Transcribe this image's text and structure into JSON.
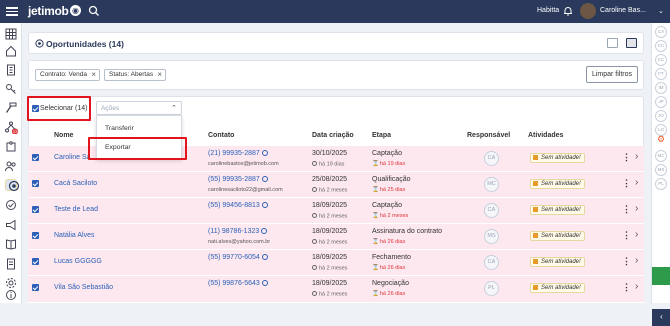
{
  "topbar": {
    "brand": "jetimob",
    "company": "Habitta",
    "user_name": "Caroline Bas...",
    "user_chevron": "⌄"
  },
  "page": {
    "title": "Oportunidades (14)"
  },
  "filters": {
    "chips": [
      {
        "label": "Contrato: Venda"
      },
      {
        "label": "Status: Abertas"
      }
    ],
    "clear_label": "Limpar filtros"
  },
  "bulk": {
    "select_label": "Selecionar (14)",
    "actions_placeholder": "Ações",
    "menu": [
      "Transferir",
      "Exportar"
    ]
  },
  "table": {
    "headers": {
      "name": "Nome",
      "contact": "Contato",
      "created": "Data criação",
      "stage": "Etapa",
      "responsible": "Responsável",
      "activities": "Atividades"
    },
    "rows": [
      {
        "name": "Caroline Sa...",
        "phone": "(21) 99935-2887",
        "email": "carolinebastos@jetimob.com",
        "date": "30/10/2025",
        "date_ago": "há 19 dias",
        "stage": "Captação",
        "stage_ago": "há 19 dias",
        "resp": "CA",
        "activity": "Sem atividade!"
      },
      {
        "name": "Cacá Saciloto",
        "phone": "(55) 99935-2887",
        "email": "carolinesaciloto22@gmail.com",
        "date": "25/08/2025",
        "date_ago": "há 2 meses",
        "stage": "Qualificação",
        "stage_ago": "há 25 dias",
        "resp": "MC",
        "activity": "Sem atividade!"
      },
      {
        "name": "Teste de Lead",
        "phone": "(55) 99456-8813",
        "email": "",
        "date": "18/09/2025",
        "date_ago": "há 2 meses",
        "stage": "Captação",
        "stage_ago": "há 2 meses",
        "resp": "CA",
        "activity": "Sem atividade!"
      },
      {
        "name": "Natália Alves",
        "phone": "(11) 98786-1323",
        "email": "nati.alves@yahoo.com.br",
        "date": "18/09/2025",
        "date_ago": "há 2 meses",
        "stage": "Assinatura do contrato",
        "stage_ago": "há 26 dias",
        "resp": "MS",
        "activity": "Sem atividade!"
      },
      {
        "name": "Lucas GGGGG",
        "phone": "(55) 99770-6054",
        "email": "",
        "date": "18/09/2025",
        "date_ago": "há 2 meses",
        "stage": "Fechamento",
        "stage_ago": "há 26 dias",
        "resp": "CA",
        "activity": "Sem atividade!"
      },
      {
        "name": "Vila São Sebastião",
        "phone": "(55) 99876-5643",
        "email": "",
        "date": "18/09/2025",
        "date_ago": "há 2 meses",
        "stage": "Negociação",
        "stage_ago": "há 26 dias",
        "resp": "PL",
        "activity": "Sem atividade!"
      }
    ]
  },
  "left_nav": {
    "badge": "23"
  },
  "right_nav": {
    "avatars": [
      "CA",
      "CC",
      "CC",
      "FT",
      "IM",
      "JP",
      "JO",
      "LG",
      "MC",
      "MS",
      "PL"
    ]
  },
  "colors": {
    "topbar": "#2b3a5c",
    "row_bg": "#fce8ee",
    "link": "#2b5fb8",
    "highlight": "#e1131c",
    "alert": "#e1343a"
  }
}
